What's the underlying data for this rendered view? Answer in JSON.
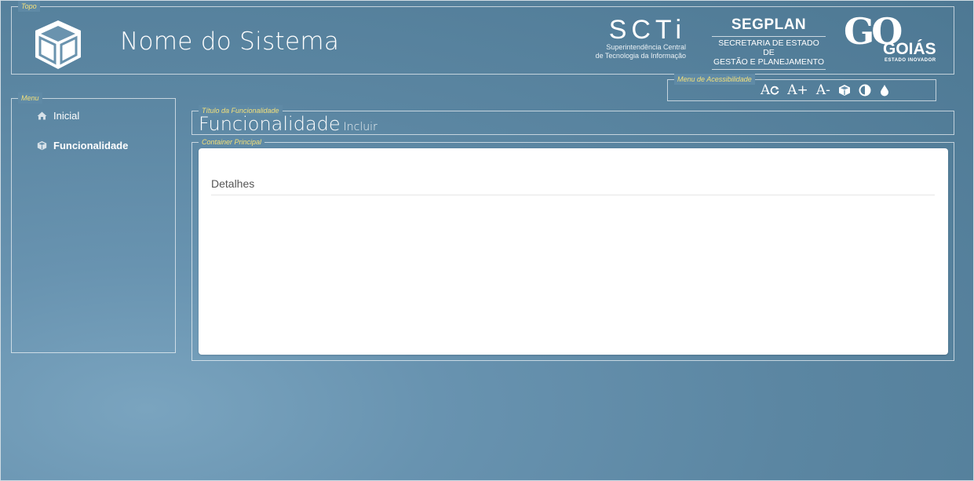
{
  "topo": {
    "legend": "Topo",
    "system_name": "Nome do Sistema",
    "logos": {
      "scti": {
        "mark": "SCTi",
        "line1": "Superintendência Central",
        "line2": "de Tecnologia da Informação"
      },
      "segplan": {
        "mark": "SEGPLAN",
        "line1": "SECRETARIA DE ESTADO DE",
        "line2": "GESTÃO E PLANEJAMENTO"
      },
      "goias": {
        "mark": "GO",
        "name": "GOIÁS",
        "tagline": "ESTADO INOVADOR"
      }
    }
  },
  "acessibilidade": {
    "legend": "Menu de Acessibilidade",
    "tools": [
      {
        "icon": "font-reset-icon",
        "label": "A"
      },
      {
        "icon": "font-increase-icon",
        "label": "A+"
      },
      {
        "icon": "font-decrease-icon",
        "label": "A-"
      },
      {
        "icon": "cube-icon",
        "label": ""
      },
      {
        "icon": "contrast-icon",
        "label": ""
      },
      {
        "icon": "drop-icon",
        "label": ""
      }
    ]
  },
  "menu": {
    "legend": "Menu",
    "items": [
      {
        "label": "Inicial",
        "icon": "home-icon",
        "active": false
      },
      {
        "label": "Funcionalidade",
        "icon": "cube-icon",
        "active": true
      }
    ]
  },
  "titulo": {
    "legend": "Título da Funcionalidade",
    "main": "Funcionalidade",
    "sub": "Incluir"
  },
  "container": {
    "legend": "Container Principal",
    "section_title": "Detalhes"
  },
  "colors": {
    "legend": "#f3e07a",
    "background": "#5f8aa6",
    "panel": "#ffffff"
  }
}
